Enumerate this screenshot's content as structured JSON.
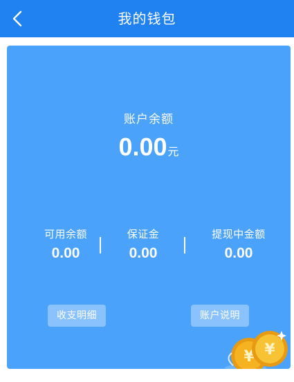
{
  "header": {
    "title": "我的钱包",
    "back_icon": "chevron-left-icon"
  },
  "wallet": {
    "balance_label": "账户余额",
    "balance_amount": "0.00",
    "balance_unit": "元",
    "stats": [
      {
        "label": "可用余额",
        "value": "0.00"
      },
      {
        "label": "保证金",
        "value": "0.00"
      },
      {
        "label": "提现中金额",
        "value": "0.00"
      }
    ],
    "actions": {
      "records_label": "收支明细",
      "account_info_label": "账户说明"
    },
    "decoration_icon": "coins-icon"
  },
  "colors": {
    "header_bg": "#1f82f0",
    "card_bg": "#4aa2fb",
    "text": "#ffffff",
    "coin_gold": "#f5b321"
  }
}
